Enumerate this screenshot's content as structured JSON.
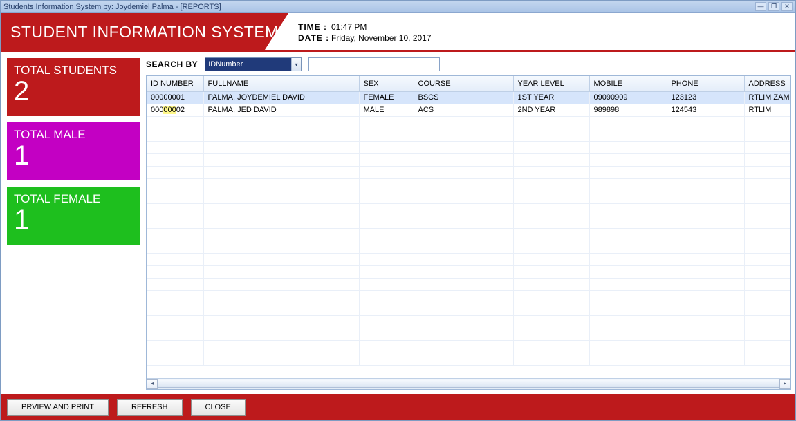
{
  "window": {
    "title": "Students Information System by: Joydemiel Palma - [REPORTS]",
    "min_icon": "—",
    "restore_icon": "❐",
    "close_icon": "✕"
  },
  "banner": {
    "title": "STUDENT INFORMATION SYSTEM"
  },
  "datetime": {
    "time_label": "TIME :",
    "time_value": "01:47 PM",
    "date_label": "DATE :",
    "date_value": "Friday, November 10, 2017"
  },
  "stats": {
    "total_students": {
      "label": "TOTAL STUDENTS",
      "value": "2"
    },
    "total_male": {
      "label": "TOTAL MALE",
      "value": "1"
    },
    "total_female": {
      "label": "TOTAL FEMALE",
      "value": "1"
    }
  },
  "search": {
    "label": "SEARCH BY",
    "selected": "IDNumber",
    "input_value": ""
  },
  "grid": {
    "columns": [
      "ID NUMBER",
      "FULLNAME",
      "SEX",
      "COURSE",
      "YEAR LEVEL",
      "MOBILE",
      "PHONE",
      "ADDRESS"
    ],
    "rows": [
      {
        "id": "00000001",
        "fullname": "PALMA, JOYDEMIEL DAVID",
        "sex": "FEMALE",
        "course": "BSCS",
        "year": "1ST YEAR",
        "mobile": "09090909",
        "phone": "123123",
        "address": "RTLIM ZAM"
      },
      {
        "id": "00000002",
        "fullname": "PALMA, JED DAVID",
        "sex": "MALE",
        "course": "ACS",
        "year": "2ND YEAR",
        "mobile": "989898",
        "phone": "124543",
        "address": "RTLIM"
      }
    ],
    "selected_index": 0
  },
  "footer": {
    "preview": "PRVIEW AND PRINT",
    "refresh": "REFRESH",
    "close": "CLOSE"
  }
}
